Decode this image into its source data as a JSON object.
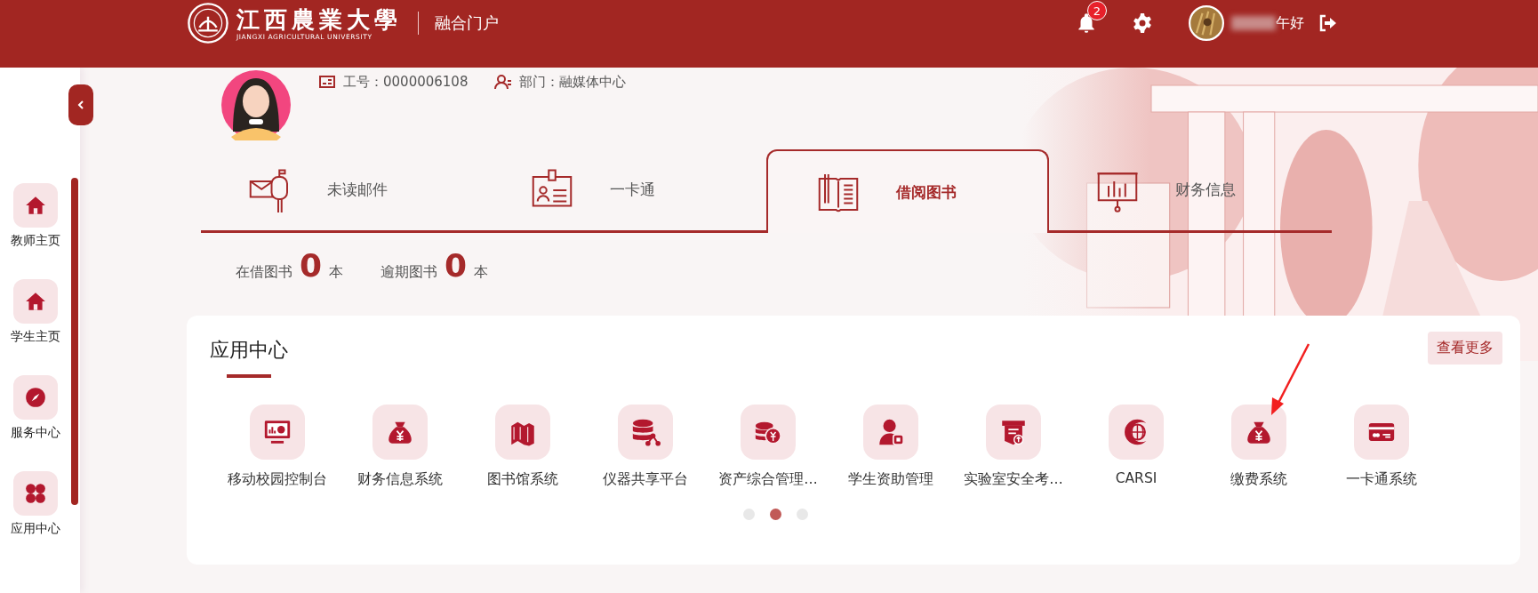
{
  "header": {
    "logo_cn": "江西農業大學",
    "logo_en": "JIANGXI AGRICULTURAL UNIVERSITY",
    "portal": "融合门户",
    "notifications": "2",
    "greeting": "午好"
  },
  "sidebar": {
    "items": [
      {
        "label": "教师主页"
      },
      {
        "label": "学生主页"
      },
      {
        "label": "服务中心"
      },
      {
        "label": "应用中心"
      }
    ]
  },
  "profile": {
    "staff_id": "工号：0000006108",
    "department": "部门：融媒体中心"
  },
  "tabs": [
    {
      "label": "未读邮件",
      "selected": false
    },
    {
      "label": "一卡通",
      "selected": false
    },
    {
      "label": "借阅图书",
      "selected": true
    },
    {
      "label": "财务信息",
      "selected": false
    }
  ],
  "stats": [
    {
      "label": "在借图书",
      "value": "0",
      "unit": "本"
    },
    {
      "label": "逾期图书",
      "value": "0",
      "unit": "本"
    }
  ],
  "app_center": {
    "title": "应用中心",
    "more": "查看更多",
    "items": [
      {
        "label": "移动校园控制台"
      },
      {
        "label": "财务信息系统"
      },
      {
        "label": "图书馆系统"
      },
      {
        "label": "仪器共享平台"
      },
      {
        "label": "资产综合管理…"
      },
      {
        "label": "学生资助管理"
      },
      {
        "label": "实验室安全考…"
      },
      {
        "label": "CARSI"
      },
      {
        "label": "缴费系统"
      },
      {
        "label": "一卡通系统"
      }
    ],
    "pages": [
      {
        "selected": false
      },
      {
        "selected": true
      },
      {
        "selected": false
      }
    ]
  }
}
